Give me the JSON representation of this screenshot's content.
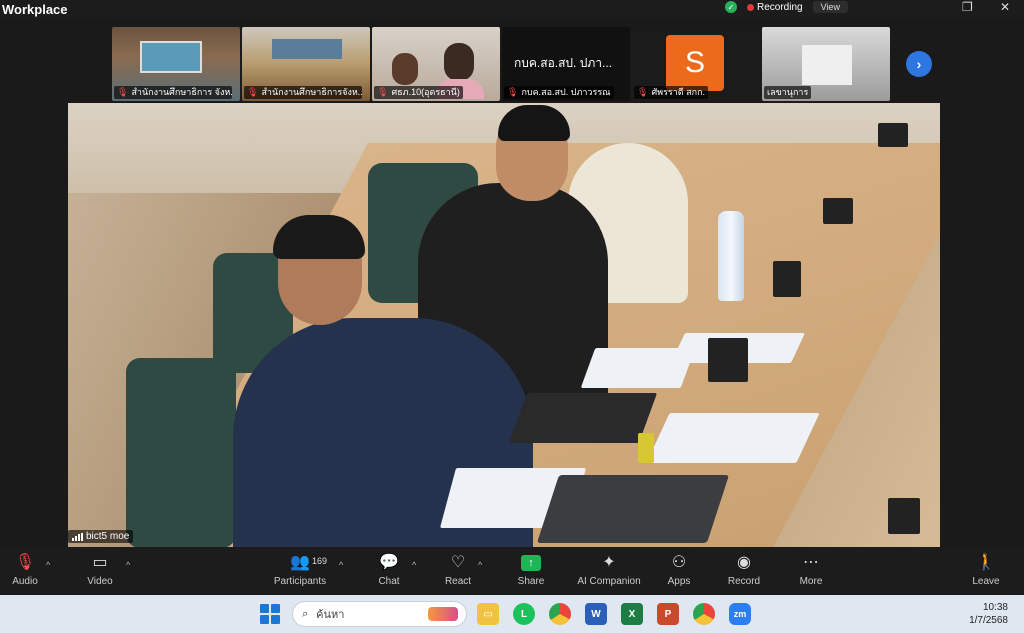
{
  "window": {
    "title": "Workplace",
    "recording_label": "Recording",
    "view_label": "View",
    "ctrl_restore": "❐",
    "ctrl_close": "✕"
  },
  "thumbnails": [
    {
      "caption": "สำนักงานศึกษาธิการ จังห...",
      "muted": true
    },
    {
      "caption": "สำนักงานศึกษาธิการจังห...",
      "muted": true
    },
    {
      "caption": "ศธภ.10(อุดรธานี)",
      "muted": true
    },
    {
      "caption": "กบค.สอ.สป. ปภาวรรณ",
      "muted": true,
      "display_name": "กบค.สอ.สป. ปภา..."
    },
    {
      "caption": "ศัพรราดี สกก.",
      "muted": true,
      "avatar_letter": "S"
    },
    {
      "caption": "เลขานุการ",
      "muted": false
    }
  ],
  "main_video": {
    "name_tag": "bict5 moe"
  },
  "toolbar": {
    "audio": "Audio",
    "video": "Video",
    "participants": "Participants",
    "participant_count": "169",
    "chat": "Chat",
    "react": "React",
    "share": "Share",
    "ai_companion": "AI Companion",
    "apps": "Apps",
    "record": "Record",
    "more": "More",
    "leave": "Leave"
  },
  "taskbar": {
    "search_placeholder": "ค้นหา",
    "apps": [
      "file-explorer",
      "line",
      "chrome",
      "word",
      "excel",
      "powerpoint",
      "chrome-profile",
      "zoom"
    ],
    "time": "10:38",
    "date": "1/7/2568"
  },
  "colors": {
    "accent_blue": "#2f77e0",
    "share_green": "#1fb456",
    "muted_red": "#ff4d4d",
    "avatar_orange": "#ec6b1a"
  }
}
